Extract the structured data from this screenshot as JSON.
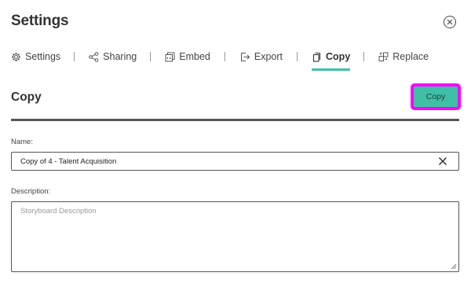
{
  "header": {
    "title": "Settings",
    "close_icon": "close-circle-icon"
  },
  "tabs": [
    {
      "label": "Settings",
      "icon": "gear-icon",
      "active": false
    },
    {
      "label": "Sharing",
      "icon": "share-icon",
      "active": false
    },
    {
      "label": "Embed",
      "icon": "embed-icon",
      "active": false
    },
    {
      "label": "Export",
      "icon": "export-icon",
      "active": false
    },
    {
      "label": "Copy",
      "icon": "copy-icon",
      "active": true
    },
    {
      "label": "Replace",
      "icon": "replace-icon",
      "active": false
    }
  ],
  "section": {
    "title": "Copy",
    "copy_button_label": "Copy"
  },
  "form": {
    "name_label": "Name:",
    "name_value": "Copy of 4 - Talent Acquisition",
    "description_label": "Description:",
    "description_placeholder": "Storyboard Description",
    "description_value": ""
  },
  "colors": {
    "accent": "#3dbfa8",
    "highlight": "#ff00ff",
    "button": "#3fbfa6"
  }
}
